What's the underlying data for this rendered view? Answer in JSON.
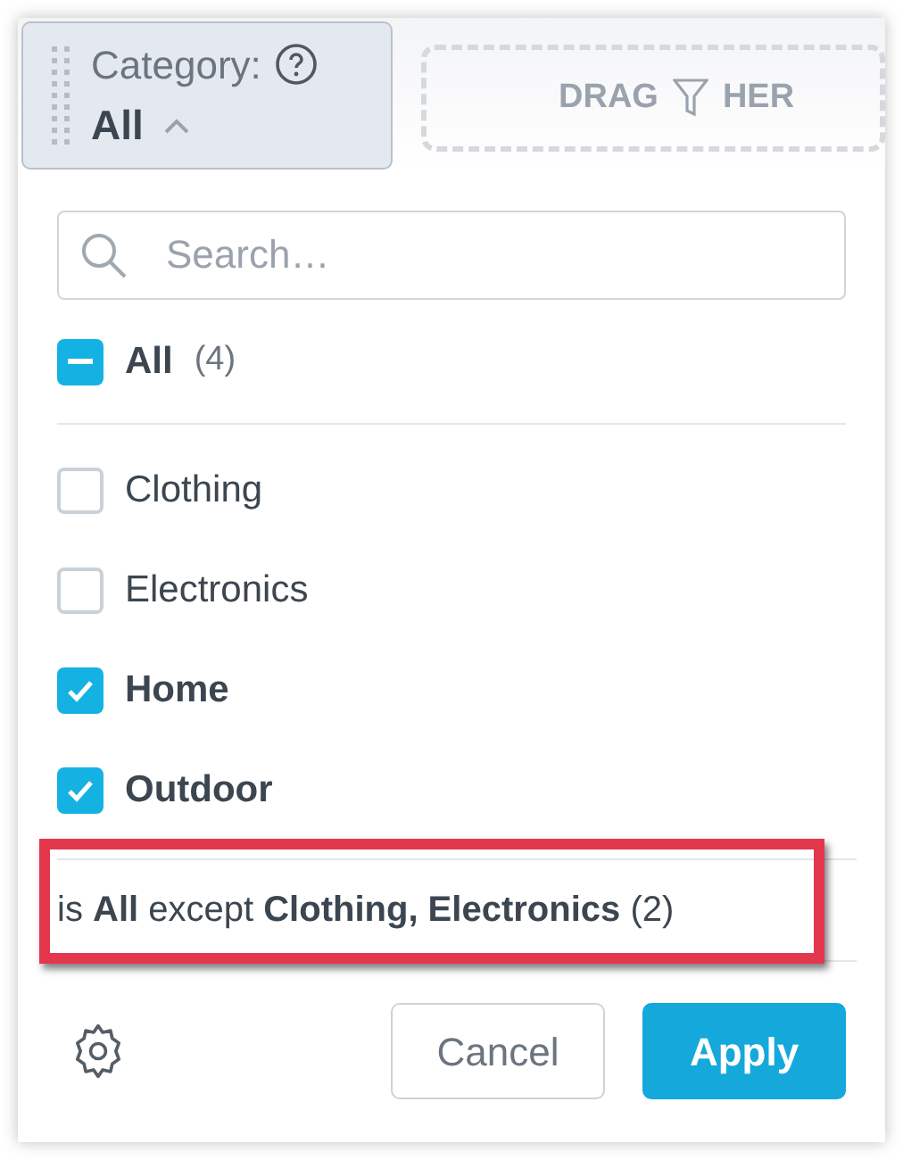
{
  "filter_chip": {
    "label": "Category:",
    "value": "All",
    "expanded": true
  },
  "drop_zone": {
    "before": "DRAG",
    "after": "HER"
  },
  "search": {
    "placeholder": "Search…"
  },
  "all_option": {
    "label": "All",
    "count": "(4)",
    "partial": true
  },
  "options": [
    {
      "label": "Clothing",
      "checked": false
    },
    {
      "label": "Electronics",
      "checked": false
    },
    {
      "label": "Home",
      "checked": true
    },
    {
      "label": "Outdoor",
      "checked": true
    }
  ],
  "summary": "is **All** except **Clothing, Electronics** (2)",
  "highlighted": true,
  "buttons": {
    "cancel": "Cancel",
    "apply": "Apply"
  }
}
